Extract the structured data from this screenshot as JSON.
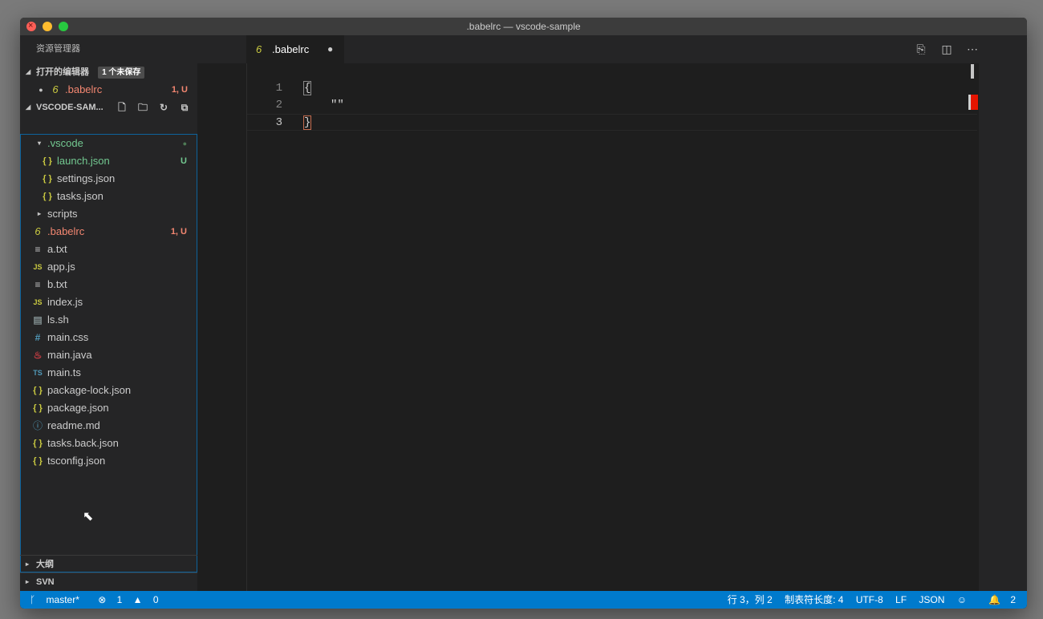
{
  "window": {
    "title": ".babelrc — vscode-sample"
  },
  "sidebar": {
    "title": "资源管理器",
    "open_editors": {
      "header": "打开的编辑器",
      "badge": "1 个未保存",
      "items": [
        {
          "dot": "●",
          "icon": "6",
          "label": ".babelrc",
          "deco": "1, U"
        }
      ]
    },
    "explorer": {
      "header": "VSCODE-SAM...",
      "actions": [
        "new-file-icon",
        "new-folder-icon",
        "refresh-icon",
        "collapse-all-icon"
      ],
      "tree": [
        {
          "label": ".vscode",
          "deco": "●",
          "icon": "▾"
        },
        {
          "label": "launch.json",
          "deco": "U",
          "icon": "{ }"
        },
        {
          "label": "settings.json",
          "deco": "",
          "icon": "{ }"
        },
        {
          "label": "tasks.json",
          "deco": "",
          "icon": "{ }"
        },
        {
          "label": "scripts",
          "deco": "",
          "icon": "▸"
        },
        {
          "label": ".babelrc",
          "deco": "1, U",
          "icon": "6"
        },
        {
          "label": "a.txt",
          "deco": "",
          "icon": "≡"
        },
        {
          "label": "app.js",
          "deco": "",
          "icon": "JS"
        },
        {
          "label": "b.txt",
          "deco": "",
          "icon": "≡"
        },
        {
          "label": "index.js",
          "deco": "",
          "icon": "JS"
        },
        {
          "label": "ls.sh",
          "deco": "",
          "icon": "▤"
        },
        {
          "label": "main.css",
          "deco": "",
          "icon": "#"
        },
        {
          "label": "main.java",
          "deco": "",
          "icon": "♨"
        },
        {
          "label": "main.ts",
          "deco": "",
          "icon": "TS"
        },
        {
          "label": "package-lock.json",
          "deco": "",
          "icon": "{ }"
        },
        {
          "label": "package.json",
          "deco": "",
          "icon": "{ }"
        },
        {
          "label": "readme.md",
          "deco": "",
          "icon": "ⓘ"
        },
        {
          "label": "tasks.back.json",
          "deco": "",
          "icon": "{ }"
        },
        {
          "label": "tsconfig.json",
          "deco": "",
          "icon": "{ }"
        }
      ]
    },
    "outline": {
      "header": "大纲"
    },
    "svn": {
      "header": "SVN"
    }
  },
  "editor": {
    "tab": {
      "icon": "6",
      "label": ".babelrc",
      "dirty": "●"
    },
    "actions": [
      "open-changes-icon",
      "split-editor-icon",
      "more-actions-icon"
    ],
    "lines": [
      {
        "num": "1",
        "text": "{"
      },
      {
        "num": "2",
        "text": "\"\""
      },
      {
        "num": "3",
        "text": "}"
      }
    ]
  },
  "statusbar": {
    "branch": "master*",
    "errors": "1",
    "warnings": "0",
    "position": "行 3，列 2",
    "indent": "制表符长度: 4",
    "encoding": "UTF-8",
    "eol": "LF",
    "language": "JSON",
    "notifications": "2"
  },
  "colors": {
    "accent": "#007acc",
    "untracked": "#73c991",
    "error": "#f48771",
    "tree_border": "#0e639c"
  }
}
